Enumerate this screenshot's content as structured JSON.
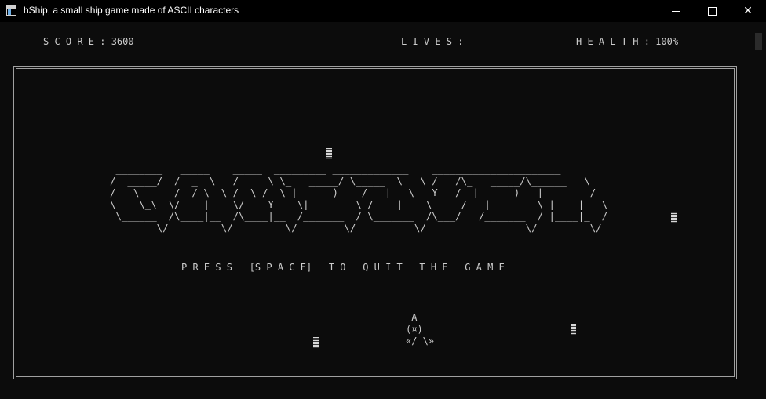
{
  "window": {
    "title": "hShip, a small ship game made of ASCII characters",
    "icon": "console-app-icon",
    "controls": [
      "minimize",
      "maximize",
      "close"
    ]
  },
  "hud": {
    "score": "S C O R E : 3600",
    "lives": "L I V E S :",
    "health": "H E A L T H : 100%"
  },
  "game": {
    "gameover_art": " ________   _____    _____  _________ _____________    ______________________  \n/  _____/  /  _  \\   /     \\ \\_   _____/ \\_____  \\   \\ /   /\\_   _____/\\______   \\ \n/   \\  ___ /  /_\\  \\ /  \\ /  \\ |    __)_   /   |   \\   Y   /  |    __)_  |       _/\n\\    \\_\\  \\/    |    \\/    Y    \\|        \\ /    |    \\     /   |        \\ |    |   \\\n \\______  /\\____|__  /\\____|__  /_______  / \\_______  /\\___/   /_______  / |____|_  /\n        \\/         \\/         \\/        \\/          \\/                 \\/         \\/ ",
    "quit_message": "P R E S S   [S P A C E]   T O   Q U I T   T H E   G A M E",
    "ship": " A\n(¤)\n«/ \\»"
  }
}
